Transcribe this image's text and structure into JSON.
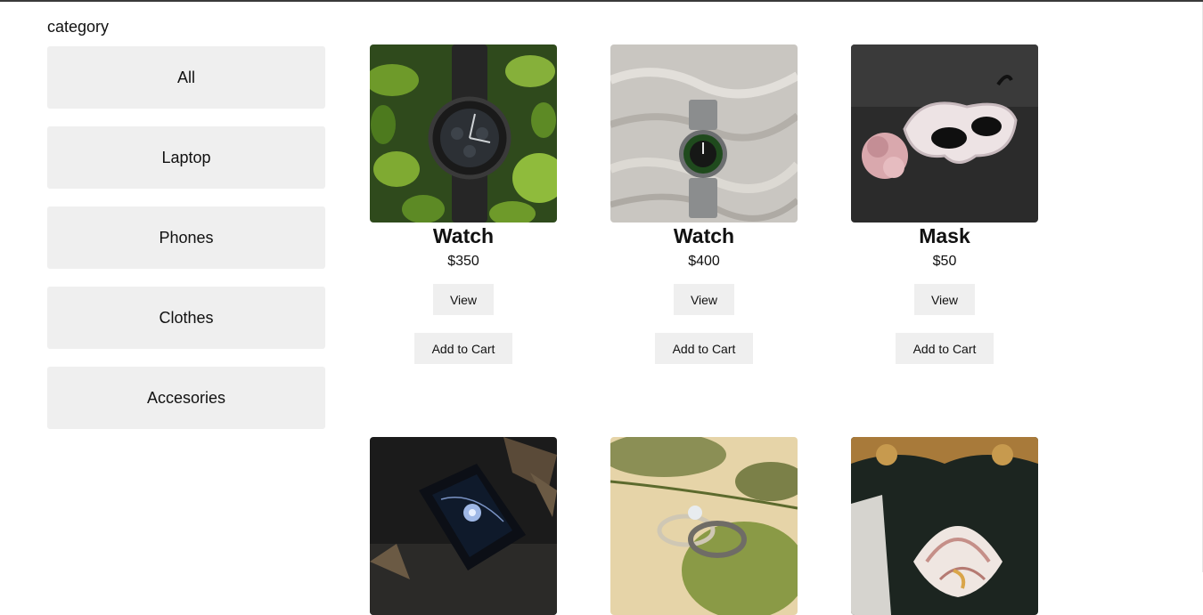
{
  "sidebar": {
    "title": "category",
    "items": [
      {
        "label": "All"
      },
      {
        "label": "Laptop"
      },
      {
        "label": "Phones"
      },
      {
        "label": "Clothes"
      },
      {
        "label": "Accesories"
      }
    ]
  },
  "products": [
    {
      "name": "Watch",
      "price": "$350",
      "view_label": "View",
      "cart_label": "Add to Cart",
      "image": "watch-on-green-leaves"
    },
    {
      "name": "Watch",
      "price": "$400",
      "view_label": "View",
      "cart_label": "Add to Cart",
      "image": "watch-on-white-fabric"
    },
    {
      "name": "Mask",
      "price": "$50",
      "view_label": "View",
      "cart_label": "Add to Cart",
      "image": "masquerade-mask"
    },
    {
      "image": "jewelry-box-necklace"
    },
    {
      "image": "rings-on-leaf"
    },
    {
      "image": "seashell-jewelry"
    }
  ]
}
